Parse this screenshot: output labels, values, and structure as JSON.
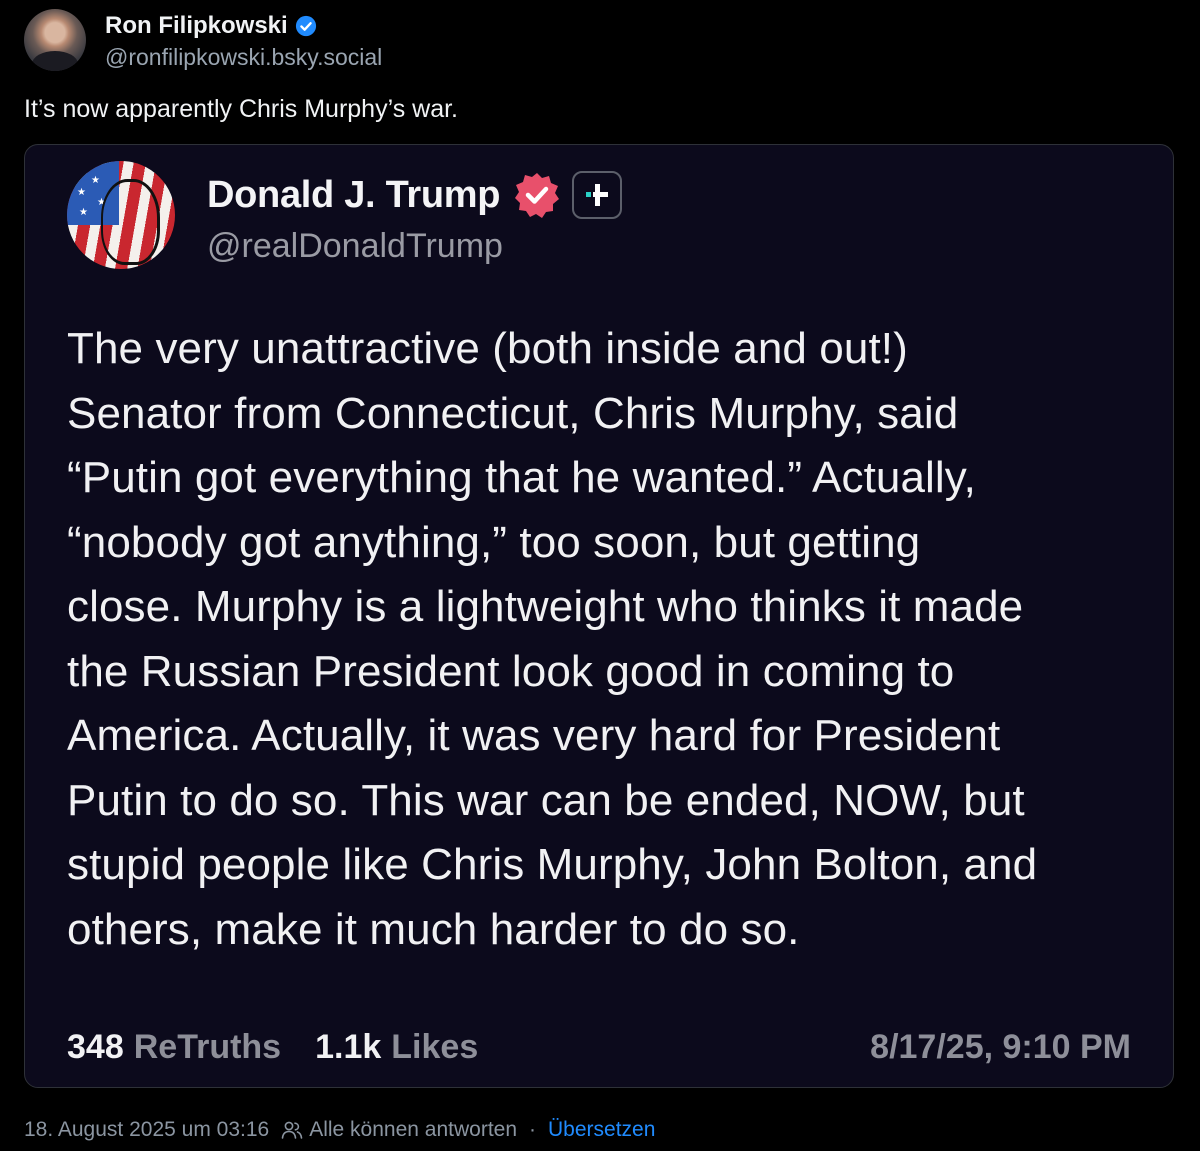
{
  "author": {
    "display_name": "Ron Filipkowski",
    "handle": "@ronfilipkowski.bsky.social",
    "verified_color": "#208bfe"
  },
  "post": {
    "text": "It’s now apparently Chris Murphy’s war."
  },
  "embed": {
    "display_name": "Donald J. Trump",
    "handle": "@realDonaldTrump",
    "verified_badge_color": "#e8506b",
    "body": "The very unattractive (both inside and out!)\nSenator from Connecticut, Chris Murphy, said\n“Putin got everything that he wanted.” Actually,\n“nobody got anything,” too soon, but getting\nclose. Murphy is a lightweight who thinks it made\nthe Russian President look good in coming to\nAmerica. Actually, it was very hard for President\nPutin to do so. This war can be ended, NOW, but\nstupid people like Chris Murphy, John Bolton, and\nothers, make it much harder to do so.",
    "stats": {
      "retruths_count": "348",
      "retruths_label": "ReTruths",
      "likes_count": "1.1k",
      "likes_label": "Likes"
    },
    "timestamp": "8/17/25, 9:10 PM"
  },
  "footer": {
    "date": "18. August 2025 um 03:16",
    "reply_setting": "Alle können antworten",
    "separator": "·",
    "translate_label": "Übersetzen",
    "link_color": "#208bfe"
  }
}
